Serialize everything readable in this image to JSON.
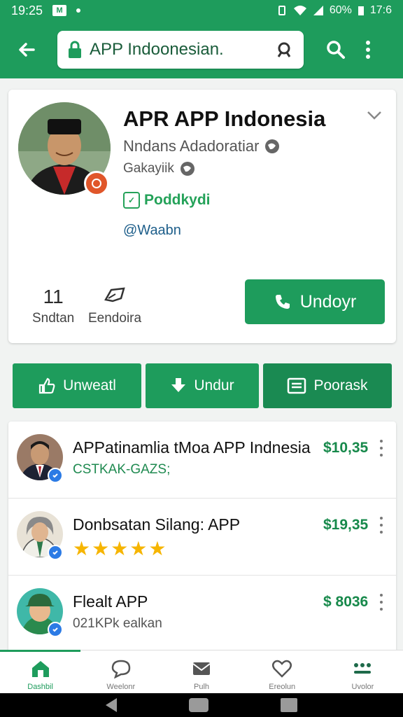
{
  "status_bar": {
    "time": "19:25",
    "battery": "60%",
    "clock_right": "17:6"
  },
  "search": {
    "value": "APP Indoonesian."
  },
  "profile": {
    "title": "APR APP Indonesia",
    "subtitle": "Nndans Adadoratiar",
    "location": "Gakayiik",
    "tag": "Poddkydi",
    "handle": "@Waabn",
    "stats": [
      {
        "number": "11",
        "label": "Sndtan"
      },
      {
        "number": "",
        "label": "Eendoira"
      }
    ],
    "primary_button": "Undoyr"
  },
  "actions": [
    {
      "label": "Unweatl",
      "icon": "thumbs-up-icon"
    },
    {
      "label": "Undur",
      "icon": "download-icon"
    },
    {
      "label": "Poorask",
      "icon": "document-icon"
    }
  ],
  "list": [
    {
      "title": "APPatinamlia tMoa APP Indnesia",
      "subtitle": "CSTKAK-GAZS;",
      "price": "$10,35"
    },
    {
      "title": "Donbsatan Silang: APP",
      "stars": "★★★★★",
      "price": "$19,35"
    },
    {
      "title": "Flealt APP",
      "subtitle": "021KPk ealkan",
      "price": "$ 8036"
    }
  ],
  "bottom_nav": [
    {
      "label": "Dashbil",
      "icon": "home-icon"
    },
    {
      "label": "Weelonr",
      "icon": "chat-icon"
    },
    {
      "label": "Pulh",
      "icon": "mail-icon"
    },
    {
      "label": "Ereolun",
      "icon": "heart-icon"
    },
    {
      "label": "Uvolor",
      "icon": "grid-icon"
    }
  ],
  "colors": {
    "primary": "#1e9c5c",
    "price": "#17894b",
    "star": "#f6b500"
  }
}
